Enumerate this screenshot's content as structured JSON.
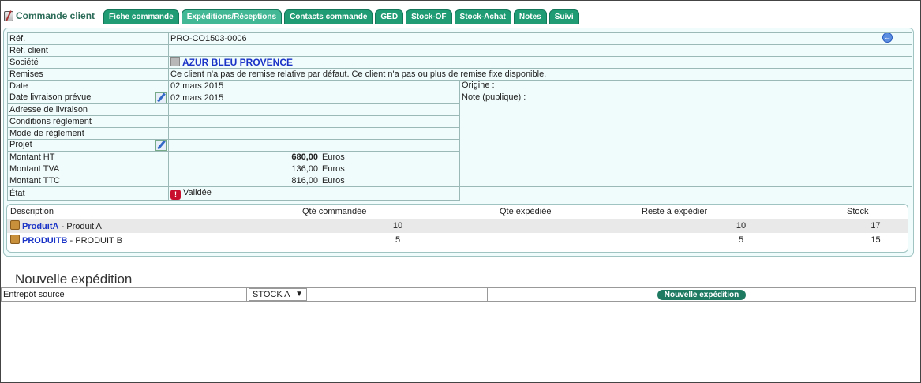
{
  "header": {
    "title": "Commande client",
    "tabs": [
      {
        "label": "Fiche commande",
        "active": false
      },
      {
        "label": "Expéditions/Réceptions",
        "active": true
      },
      {
        "label": "Contacts commande",
        "active": false
      },
      {
        "label": "GED",
        "active": false
      },
      {
        "label": "Stock-OF",
        "active": false
      },
      {
        "label": "Stock-Achat",
        "active": false
      },
      {
        "label": "Notes",
        "active": false
      },
      {
        "label": "Suivi",
        "active": false
      }
    ]
  },
  "order": {
    "ref_label": "Réf.",
    "ref": "PRO-CO1503-0006",
    "ref_client_label": "Réf. client",
    "ref_client": "",
    "company_label": "Société",
    "company": "AZUR BLEU PROVENCE",
    "discounts_label": "Remises",
    "discounts": "Ce client n'a pas de remise relative par défaut. Ce client n'a pas ou plus de remise fixe disponible.",
    "date_label": "Date",
    "date": "02 mars 2015",
    "origin_label": "Origine :",
    "note_label": "Note (publique) :",
    "delivery_date_label": "Date livraison prévue",
    "delivery_date": "02 mars 2015",
    "delivery_address_label": "Adresse de livraison",
    "payment_terms_label": "Conditions règlement",
    "payment_mode_label": "Mode de règlement",
    "project_label": "Projet",
    "amount_ht_label": "Montant HT",
    "amount_ht": "680,00",
    "amount_tva_label": "Montant TVA",
    "amount_tva": "136,00",
    "amount_ttc_label": "Montant TTC",
    "amount_ttc": "816,00",
    "currency": "Euros",
    "status_label": "État",
    "status": "Validée"
  },
  "lines": {
    "headers": [
      "Description",
      "Qté commandée",
      "Qté expédiée",
      "Reste à expédier",
      "Stock"
    ],
    "rows": [
      {
        "ref": "ProduitA",
        "label": " - Produit A",
        "ordered": "10",
        "shipped": "",
        "remaining": "10",
        "stock": "17"
      },
      {
        "ref": "PRODUITB",
        "label": " - PRODUIT B",
        "ordered": "5",
        "shipped": "",
        "remaining": "5",
        "stock": "15"
      }
    ]
  },
  "new_shipment": {
    "title": "Nouvelle expédition",
    "warehouse_label": "Entrepôt source",
    "warehouse_value": "STOCK A",
    "button_label": "Nouvelle expédition"
  },
  "colors": {
    "tab": "#1f9c74",
    "tab_active": "#43b894",
    "card_bg": "#f0fbfb",
    "link": "#1a33c7",
    "status_red": "#c8102e"
  }
}
